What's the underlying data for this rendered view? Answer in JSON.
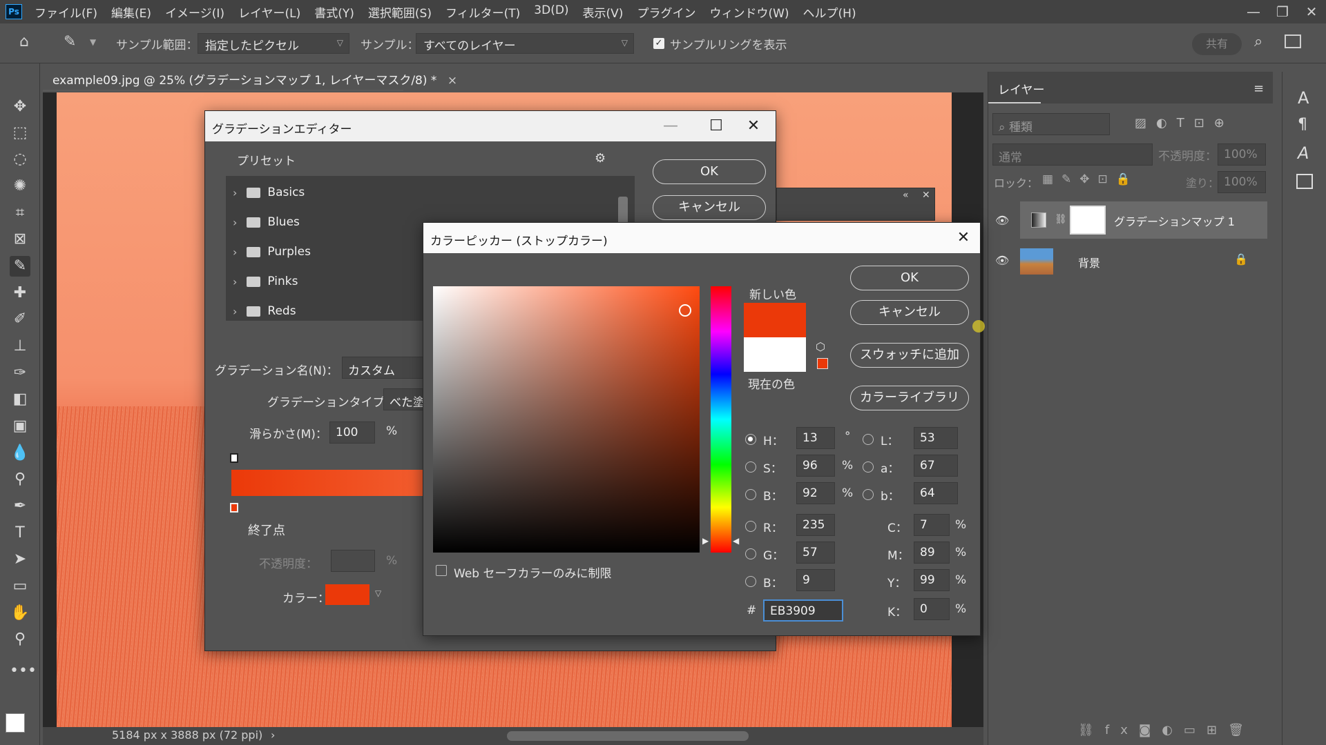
{
  "menu": [
    "ファイル(F)",
    "編集(E)",
    "イメージ(I)",
    "レイヤー(L)",
    "書式(Y)",
    "選択範囲(S)",
    "フィルター(T)",
    "3D(D)",
    "表示(V)",
    "プラグイン",
    "ウィンドウ(W)",
    "ヘルプ(H)"
  ],
  "app_logo": "Ps",
  "options": {
    "sample_range_label": "サンプル範囲：",
    "sample_range_value": "指定したピクセル",
    "sample_label": "サンプル：",
    "sample_value": "すべてのレイヤー",
    "show_ring_label": "サンプルリングを表示",
    "share_label": "共有"
  },
  "document": {
    "tab_title": "example09.jpg @ 25% (グラデーションマップ 1, レイヤーマスク/8) *",
    "status": "5184 px x 3888 px (72 ppi)"
  },
  "layers_panel": {
    "tab": "レイヤー",
    "filter_placeholder": "種類",
    "blend_mode": "通常",
    "opacity_label": "不透明度：",
    "opacity_value": "100%",
    "lock_label": "ロック：",
    "fill_label": "塗り：",
    "fill_value": "100%",
    "layers": [
      {
        "name": "グラデーションマップ 1"
      },
      {
        "name": "背景"
      }
    ]
  },
  "gradient_editor": {
    "title": "グラデーションエディター",
    "presets_label": "プリセット",
    "presets": [
      "Basics",
      "Blues",
      "Purples",
      "Pinks",
      "Reds"
    ],
    "ok": "OK",
    "cancel": "キャンセル",
    "name_label": "グラデーション名(N)：",
    "name_value": "カスタム",
    "type_label": "グラデーションタイプ：",
    "type_value": "べた塗",
    "smooth_label": "滑らかさ(M)：",
    "smooth_value": "100",
    "smooth_unit": "%",
    "stops_label": "終了点",
    "opacity_label": "不透明度：",
    "opacity_unit": "%",
    "color_label": "カラー：",
    "stop_color": "#eb3909"
  },
  "color_picker": {
    "title": "カラーピッカー (ストップカラー)",
    "ok": "OK",
    "cancel": "キャンセル",
    "add_swatch": "スウォッチに追加",
    "library": "カラーライブラリ",
    "new_label": "新しい色",
    "current_label": "現在の色",
    "new_color": "#eb3909",
    "current_color": "#ffffff",
    "web_safe_label": "Web セーフカラーのみに制限",
    "hsb": [
      {
        "label": "H：",
        "value": "13",
        "unit": "°"
      },
      {
        "label": "S：",
        "value": "96",
        "unit": "%"
      },
      {
        "label": "B：",
        "value": "92",
        "unit": "%"
      }
    ],
    "rgb": [
      {
        "label": "R：",
        "value": "235"
      },
      {
        "label": "G：",
        "value": "57"
      },
      {
        "label": "B：",
        "value": "9"
      }
    ],
    "lab": [
      {
        "label": "L：",
        "value": "53"
      },
      {
        "label": "a：",
        "value": "67"
      },
      {
        "label": "b：",
        "value": "64"
      }
    ],
    "cmyk": [
      {
        "label": "C：",
        "value": "7",
        "unit": "%"
      },
      {
        "label": "M：",
        "value": "89",
        "unit": "%"
      },
      {
        "label": "Y：",
        "value": "99",
        "unit": "%"
      },
      {
        "label": "K：",
        "value": "0",
        "unit": "%"
      }
    ],
    "hex_label": "#",
    "hex_value": "EB3909"
  }
}
